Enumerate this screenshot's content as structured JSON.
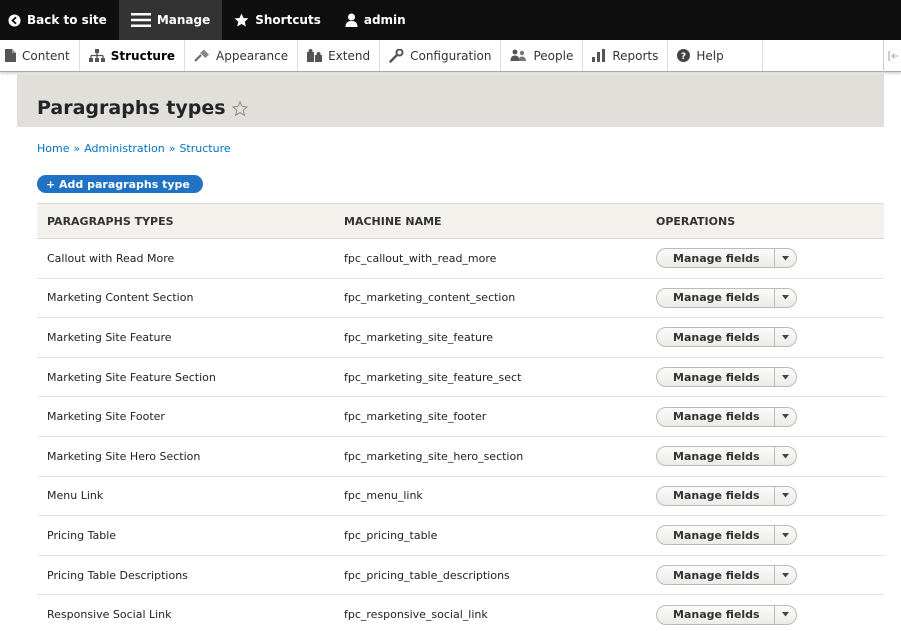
{
  "toolbar": {
    "back": "Back to site",
    "manage": "Manage",
    "shortcuts": "Shortcuts",
    "user": "admin"
  },
  "tray": {
    "items": [
      "Content",
      "Structure",
      "Appearance",
      "Extend",
      "Configuration",
      "People",
      "Reports",
      "Help"
    ],
    "active": "Structure"
  },
  "page": {
    "title": "Paragraphs types"
  },
  "breadcrumb": {
    "items": [
      "Home",
      "Administration",
      "Structure"
    ],
    "separator": "»"
  },
  "actions": {
    "add_label": "+ Add paragraphs type"
  },
  "table": {
    "headers": {
      "label": "PARAGRAPHS TYPES",
      "machine": "MACHINE NAME",
      "operations": "OPERATIONS"
    },
    "operation_label": "Manage fields",
    "rows": [
      {
        "label": "Callout with Read More",
        "machine": "fpc_callout_with_read_more"
      },
      {
        "label": "Marketing Content Section",
        "machine": "fpc_marketing_content_section"
      },
      {
        "label": "Marketing Site Feature",
        "machine": "fpc_marketing_site_feature"
      },
      {
        "label": "Marketing Site Feature Section",
        "machine": "fpc_marketing_site_feature_sect"
      },
      {
        "label": "Marketing Site Footer",
        "machine": "fpc_marketing_site_footer"
      },
      {
        "label": "Marketing Site Hero Section",
        "machine": "fpc_marketing_site_hero_section"
      },
      {
        "label": "Menu Link",
        "machine": "fpc_menu_link"
      },
      {
        "label": "Pricing Table",
        "machine": "fpc_pricing_table"
      },
      {
        "label": "Pricing Table Descriptions",
        "machine": "fpc_pricing_table_descriptions"
      },
      {
        "label": "Responsive Social Link",
        "machine": "fpc_responsive_social_link"
      }
    ]
  }
}
